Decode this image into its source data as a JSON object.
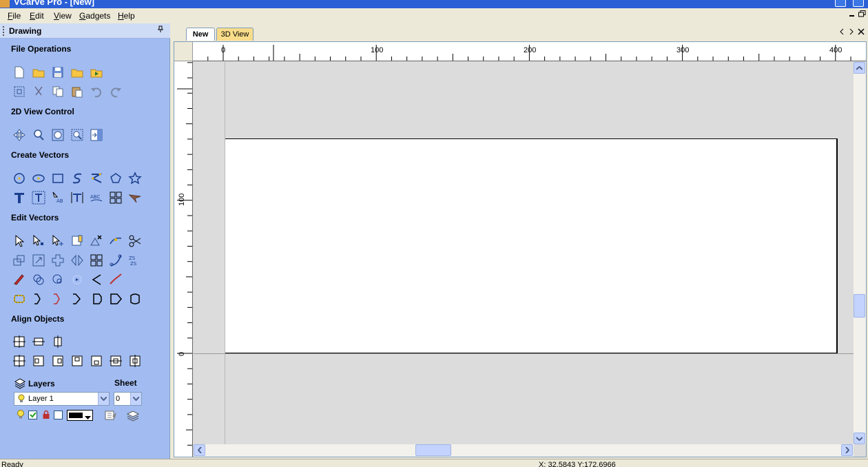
{
  "window": {
    "title": "VCarve Pro - [New]"
  },
  "menu": {
    "items": [
      {
        "label": "File",
        "underline": "F",
        "rest": "ile"
      },
      {
        "label": "Edit",
        "underline": "E",
        "rest": "dit"
      },
      {
        "label": "View",
        "underline": "V",
        "rest": "iew"
      },
      {
        "label": "Gadgets",
        "underline": "G",
        "rest": "adgets"
      },
      {
        "label": "Help",
        "underline": "H",
        "rest": "elp"
      }
    ]
  },
  "panel": {
    "title": "Drawing",
    "sections": {
      "file_operations": "File Operations",
      "view_control": "2D View Control",
      "create_vectors": "Create Vectors",
      "edit_vectors": "Edit Vectors",
      "align_objects": "Align Objects"
    },
    "layers": {
      "label": "Layers",
      "sheet_label": "Sheet",
      "layer_value": "Layer 1",
      "sheet_value": "0"
    }
  },
  "tabs": [
    {
      "label": "New",
      "active": true
    },
    {
      "label": "3D View",
      "active": false
    }
  ],
  "rulers": {
    "horizontal_labels": [
      "0",
      "100",
      "200",
      "300",
      "400"
    ],
    "vertical_labels": [
      "100",
      "0"
    ]
  },
  "status": {
    "text": "Ready",
    "coords": "X: 32.5843 Y:172.6966"
  },
  "colors": {
    "panel_bg": "#a2bcf1",
    "active_tab": "#ffffff",
    "tab_3d": "#f8dc8a",
    "canvas_bg": "#dcdcdc",
    "sheet": "#ffffff"
  }
}
